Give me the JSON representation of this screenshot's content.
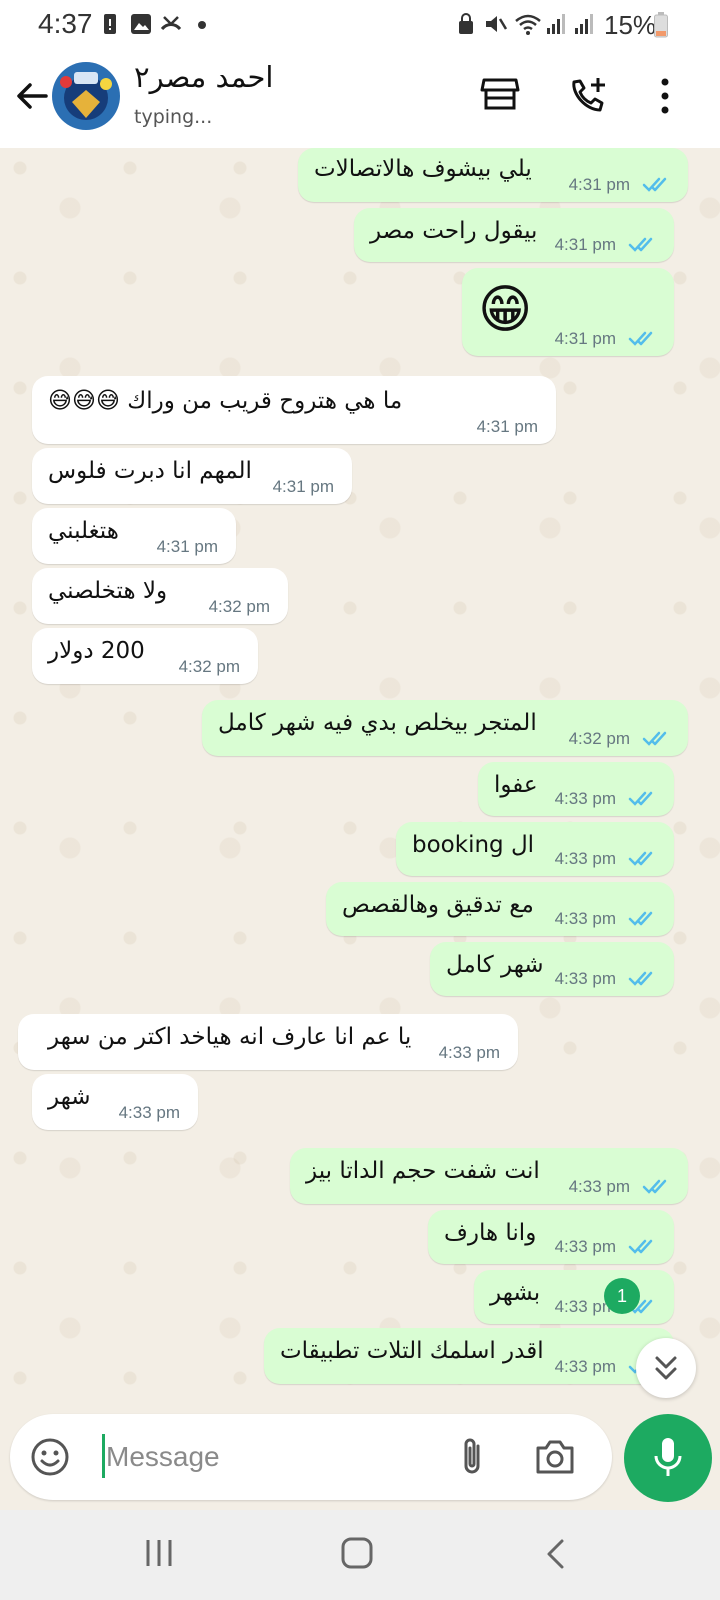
{
  "status_bar": {
    "time": "4:37",
    "battery": "15%"
  },
  "header": {
    "contact_name": "احمد مصر٢",
    "contact_status": "typing..."
  },
  "messages": [
    {
      "text": "يلي بيشوف هالاتصالات",
      "time": "4:31 pm",
      "dir": "out"
    },
    {
      "text": "بيقول راحت مصر",
      "time": "4:31 pm",
      "dir": "out"
    },
    {
      "text": "😁",
      "time": "4:31 pm",
      "dir": "out"
    },
    {
      "text": "ما هي هتروح قريب من وراك 😅😅😅",
      "time": "4:31 pm",
      "dir": "in"
    },
    {
      "text": "المهم انا دبرت فلوس",
      "time": "4:31 pm",
      "dir": "in"
    },
    {
      "text": "هتغلبني",
      "time": "4:31 pm",
      "dir": "in"
    },
    {
      "text": "ولا هتخلصني",
      "time": "4:32 pm",
      "dir": "in"
    },
    {
      "text": "200 دولار",
      "time": "4:32 pm",
      "dir": "in"
    },
    {
      "text": "المتجر بيخلص بدي فيه شهر كامل",
      "time": "4:32 pm",
      "dir": "out"
    },
    {
      "text": "عفوا",
      "time": "4:33 pm",
      "dir": "out"
    },
    {
      "text": "ال booking",
      "time": "4:33 pm",
      "dir": "out"
    },
    {
      "text": "مع تدقيق وهالقصص",
      "time": "4:33 pm",
      "dir": "out"
    },
    {
      "text": "شهر كامل",
      "time": "4:33 pm",
      "dir": "out"
    },
    {
      "text": "يا عم انا عارف انه هياخد اكتر من سهر",
      "time": "4:33 pm",
      "dir": "in"
    },
    {
      "text": "شهر",
      "time": "4:33 pm",
      "dir": "in"
    },
    {
      "text": "انت شفت حجم الداتا بيز",
      "time": "4:33 pm",
      "dir": "out"
    },
    {
      "text": "وانا هارف",
      "time": "4:33 pm",
      "dir": "out"
    },
    {
      "text": "بشهر",
      "time": "4:33 pm",
      "dir": "out"
    },
    {
      "text": "اقدر اسلمك التلات تطبيقات",
      "time": "4:33 pm",
      "dir": "out"
    }
  ],
  "unread_badge": "1",
  "composer": {
    "placeholder": "Message"
  },
  "colors": {
    "accent": "#1daa61",
    "outgoing_bubble": "#d9fdd3",
    "incoming_bubble": "#ffffff",
    "read_ticks": "#53bdeb"
  }
}
